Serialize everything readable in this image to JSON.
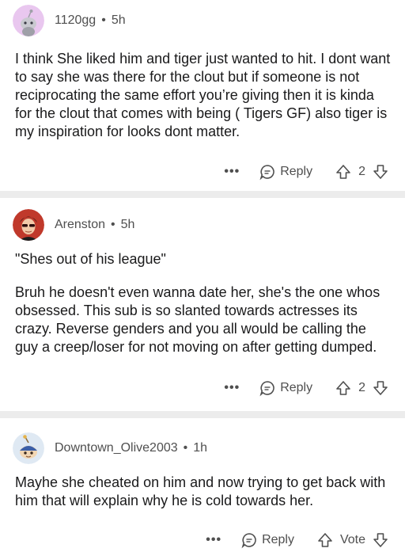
{
  "comments": [
    {
      "username": "1120gg",
      "separator": "•",
      "age": "5h",
      "paragraphs": [
        "I think She liked him and tiger just wanted to hit. I dont want to say she was there for the clout but if someone is not reciprocating the same effort you’re giving then it is kinda for the clout that comes with being ( Tigers GF) also  tiger is my inspiration for looks dont matter."
      ],
      "more_label": "•••",
      "reply_label": "Reply",
      "vote_count": "2",
      "avatar_color": "#e9c7ef"
    },
    {
      "username": "Arenston",
      "separator": "•",
      "age": "5h",
      "paragraphs": [
        "\"Shes out of his league\"",
        "Bruh he doesn't even wanna date her, she's the one whos obsessed. This sub is so slanted towards actresses its crazy. Reverse genders and you all would be calling the guy a creep/loser for not moving on after getting dumped."
      ],
      "more_label": "•••",
      "reply_label": "Reply",
      "vote_count": "2",
      "avatar_color": "#c0392b"
    },
    {
      "username": "Downtown_Olive2003",
      "separator": "•",
      "age": "1h",
      "paragraphs": [
        "Mayhe she cheated on him and now trying to get back with him that will explain why he is cold towards her."
      ],
      "more_label": "•••",
      "reply_label": "Reply",
      "vote_count": "Vote",
      "avatar_color": "#dfe9f3"
    }
  ]
}
